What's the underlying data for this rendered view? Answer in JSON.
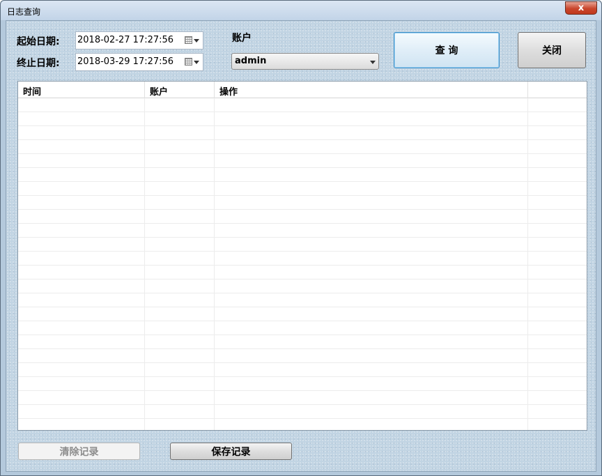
{
  "window": {
    "title": "日志查询",
    "close_glyph": "x"
  },
  "filters": {
    "start_label": "起始日期:",
    "start_value": "2018-02-27 17:27:56",
    "end_label": "终止日期:",
    "end_value": "2018-03-29 17:27:56",
    "account_label": "账户",
    "account_value": "admin"
  },
  "buttons": {
    "query": "查 询",
    "close": "关闭",
    "clear": "清除记录",
    "save": "保存记录"
  },
  "table": {
    "columns": [
      "时间",
      "账户",
      "操作",
      ""
    ],
    "rows": []
  }
}
